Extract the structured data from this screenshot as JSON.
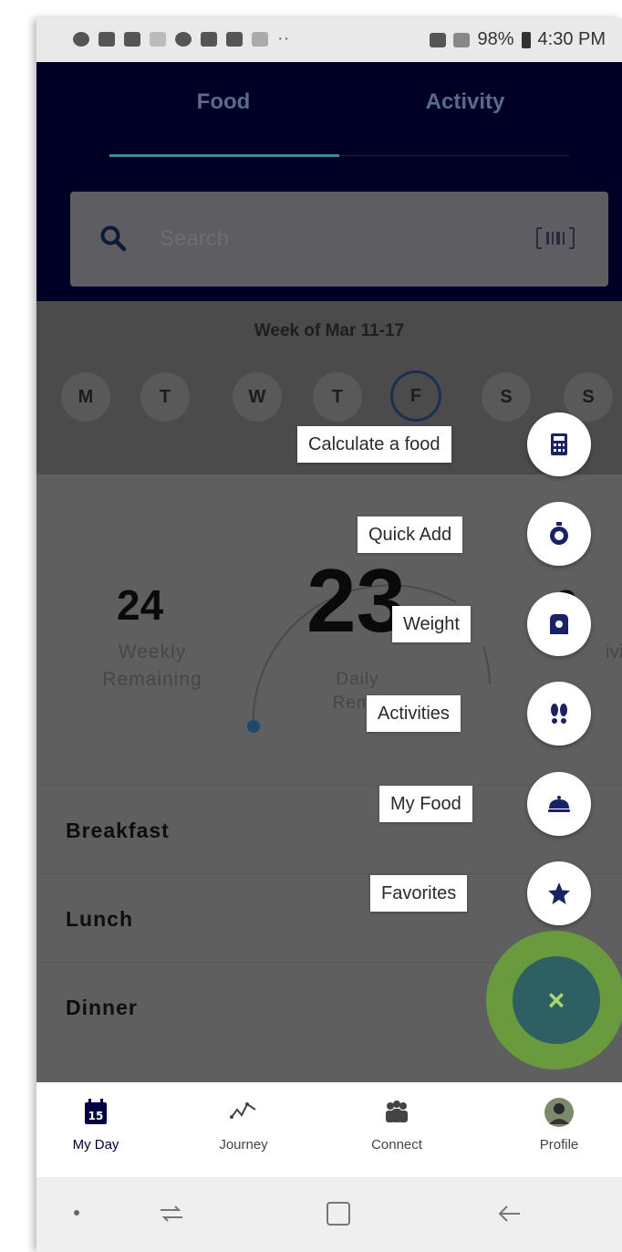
{
  "status_bar": {
    "battery": "98%",
    "time": "4:30 PM"
  },
  "tabs": [
    {
      "label": "Food"
    },
    {
      "label": "Activity"
    }
  ],
  "search": {
    "placeholder": "Search"
  },
  "week": {
    "title": "Week of Mar 11-17",
    "days": [
      "M",
      "T",
      "W",
      "T",
      "F",
      "S",
      "S"
    ],
    "selected_index": 4
  },
  "summary": {
    "weekly": {
      "value": "24",
      "label_line1": "Weekly",
      "label_line2": "Remaining"
    },
    "daily": {
      "value": "23",
      "label_line1": "Daily",
      "label_line2": "Rema"
    },
    "right": {
      "value": "0",
      "label_line1": "ivity",
      "label_line2": "d"
    }
  },
  "meals": [
    "Breakfast",
    "Lunch",
    "Dinner"
  ],
  "fab_menu": [
    {
      "label": "Calculate a food",
      "icon": "calculator-icon"
    },
    {
      "label": "Quick Add",
      "icon": "stopwatch-icon"
    },
    {
      "label": "Weight",
      "icon": "scale-icon"
    },
    {
      "label": "Activities",
      "icon": "footprints-icon"
    },
    {
      "label": "My Food",
      "icon": "food-dish-icon"
    },
    {
      "label": "Favorites",
      "icon": "star-icon"
    }
  ],
  "fab_close": "×",
  "bottom_nav": [
    {
      "label": "My Day",
      "icon": "calendar-icon",
      "badge": "15"
    },
    {
      "label": "Journey",
      "icon": "journey-line-icon"
    },
    {
      "label": "Connect",
      "icon": "people-icon"
    },
    {
      "label": "Profile",
      "icon": "avatar-icon"
    }
  ],
  "colors": {
    "header_bg": "#000026",
    "accent_teal": "#3d8a93",
    "fab_ring": "#6a9a3e",
    "fab_bg": "#2e5f62",
    "icon_navy": "#1a2266"
  }
}
